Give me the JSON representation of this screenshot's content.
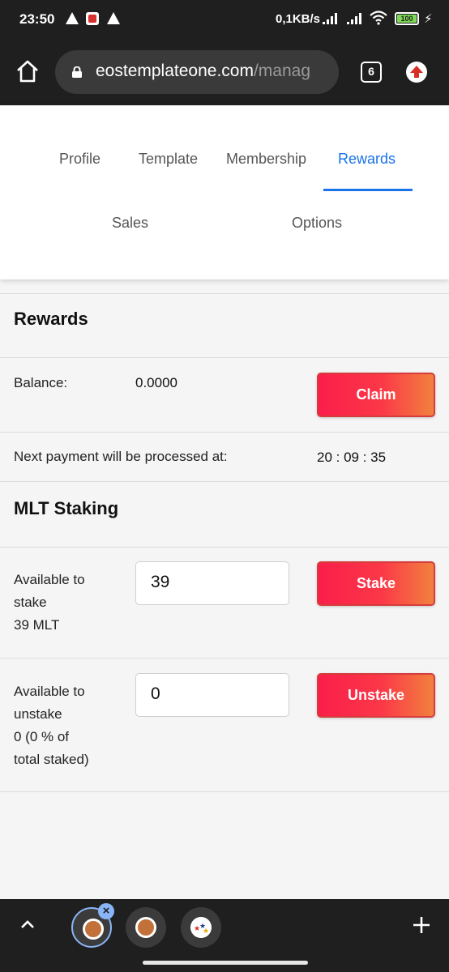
{
  "status_bar": {
    "time": "23:50",
    "network_speed": "0,1KB/s",
    "battery": "100"
  },
  "browser": {
    "url_domain": "eostemplateone.com",
    "url_path": "/manag",
    "tab_count": "6"
  },
  "nav": {
    "tabs": [
      "Profile",
      "Template",
      "Membership",
      "Rewards",
      "Sales",
      "Options"
    ],
    "active_tab": "Rewards"
  },
  "rewards": {
    "title": "Rewards",
    "balance_label": "Balance:",
    "balance_value": "0.0000",
    "claim_label": "Claim",
    "next_payment_label": "Next payment will be processed at:",
    "countdown": "20 : 09 : 35"
  },
  "staking": {
    "title": "MLT Staking",
    "available_stake_label": [
      "Available to",
      "stake",
      "39 MLT"
    ],
    "stake_input_value": "39",
    "stake_label": "Stake",
    "available_unstake_label": [
      "Available to",
      "unstake",
      "0 (0 % of",
      "total staked)"
    ],
    "unstake_input_value": "0",
    "unstake_label": "Unstake"
  },
  "colors": {
    "accent": "#1a73e8",
    "button_gradient_start": "#fa1e4a",
    "button_gradient_end": "#f2813e"
  },
  "icons": [
    "home-icon",
    "lock-icon",
    "tabs-icon",
    "update-icon",
    "chevron-up-icon",
    "close-icon",
    "plus-icon",
    "warning-icon",
    "wifi-icon",
    "battery-icon"
  ]
}
